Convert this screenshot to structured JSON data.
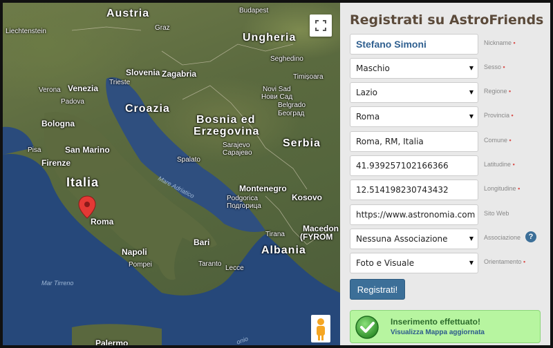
{
  "map": {
    "labels": {
      "austria": "Austria",
      "budapest": "Budapest",
      "liechtenstein": "Liechtenstein",
      "graz": "Graz",
      "ungheria": "Ungheria",
      "seghedino": "Seghedino",
      "slovenia": "Slovenia",
      "zagabria": "Zagabria",
      "timisoara": "Timișoara",
      "verona": "Verona",
      "venezia": "Venezia",
      "trieste": "Trieste",
      "padova": "Padova",
      "novisad": "Novi Sad",
      "novisad_cyr": "Нови Сад",
      "croazia": "Croazia",
      "belgrado": "Belgrado",
      "belgrado_cyr": "Београд",
      "bosnia1": "Bosnia ed",
      "bosnia2": "Erzegovina",
      "bologna": "Bologna",
      "pisa": "Pisa",
      "sanmarino": "San Marino",
      "serbia": "Serbia",
      "sarajevo": "Sarajevo",
      "sarajevo_cyr": "Сарајево",
      "firenze": "Firenze",
      "spalato": "Spalato",
      "italia": "Italia",
      "adriatico": "Mare Adriatico",
      "montenegro": "Montenegro",
      "podgorica": "Podgorica",
      "podgorica_cyr": "Подгорица",
      "kosovo": "Kosovo",
      "roma": "Roma",
      "tirana": "Tirana",
      "macedon": "Macedon",
      "fyrom": "(FYROM",
      "bari": "Bari",
      "napoli": "Napoli",
      "pompei": "Pompei",
      "albania": "Albania",
      "taranto": "Taranto",
      "lecce": "Lecce",
      "tirreno": "Mar Tirreno",
      "palermo": "Palermo",
      "ionio": "onio"
    }
  },
  "form": {
    "title": "Registrati su AstroFriends",
    "fields": [
      {
        "value": "Stefano Simoni",
        "label": "Nickname",
        "required": "•"
      },
      {
        "value": "Maschio",
        "label": "Sesso",
        "required": "•"
      },
      {
        "value": "Lazio",
        "label": "Regione",
        "required": "•"
      },
      {
        "value": "Roma",
        "label": "Provincia",
        "required": "•"
      },
      {
        "value": "Roma, RM, Italia",
        "label": "Comune",
        "required": "•"
      },
      {
        "value": "41.939257102166366",
        "label": "Latitudine",
        "required": "•"
      },
      {
        "value": "12.514198230743432",
        "label": "Longitudine",
        "required": "•"
      },
      {
        "value": "https://www.astronomia.com",
        "label": "Sito Web",
        "required": ""
      },
      {
        "value": "Nessuna Associazione",
        "label": "Associazione",
        "required": ""
      },
      {
        "value": "Foto e Visuale",
        "label": "Orientamento",
        "required": "•"
      }
    ],
    "caret": "▼",
    "help": "?",
    "submit": "Registrati!"
  },
  "alert": {
    "title": "Inserimento effettuato!",
    "link": "Visualizza Mappa aggiornata"
  },
  "icons": {
    "fullscreen": "fullscreen-icon",
    "pegman": "pegman-icon",
    "marker": "map-marker-icon",
    "check": "check-circle-icon",
    "help": "help-icon"
  }
}
